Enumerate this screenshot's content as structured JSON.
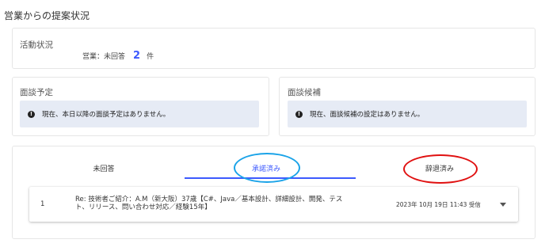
{
  "page_title": "営業からの提案状況",
  "activity": {
    "title": "活動状況",
    "label": "営業：未回答",
    "count": "2",
    "unit": "件"
  },
  "interview_schedule": {
    "title": "面談予定",
    "notice": "現在、本日以降の面談予定はありません。"
  },
  "interview_candidates": {
    "title": "面談候補",
    "notice": "現在、面談候補の設定はありません。"
  },
  "tabs": [
    {
      "label": "未回答"
    },
    {
      "label": "承諾済み"
    },
    {
      "label": "辞退済み"
    }
  ],
  "proposals": [
    {
      "no": "1",
      "subject_line1": "Re: 技術者ご紹介：A.M（新大阪）37歳【C#、Java／基本設計、詳細設計、開発、テス",
      "subject_line2": "ト、リリース、問い合わせ対応／経験15年】",
      "received": "2023年 10月 19日 11:43 受信"
    }
  ],
  "colors": {
    "accent": "#3d5afe",
    "highlight_blue": "#1aa3e8",
    "highlight_red": "#e01010",
    "notice_bg": "#e6ebf5"
  }
}
